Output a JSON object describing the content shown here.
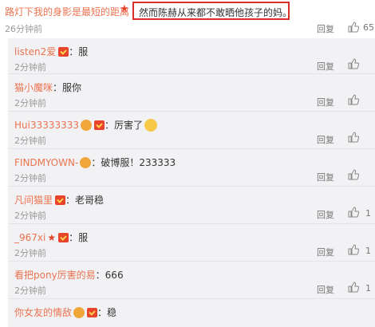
{
  "top_comment": {
    "username": "路灯下我的身影是最短的距离",
    "text": "然而陈赫从来都不敢晒他孩子的妈。",
    "time": "26分钟前",
    "reply_label": "回复",
    "likes": "65"
  },
  "replies": [
    {
      "username": "listen2爱",
      "badge": "vip",
      "text": "：服",
      "time": "2分钟前",
      "reply_label": "回复",
      "likes": ""
    },
    {
      "username": "猫小魔咪",
      "badge": "",
      "text": "：服你",
      "time": "2分钟前",
      "reply_label": "回复",
      "likes": ""
    },
    {
      "username": "Hui33333333",
      "badge": "vip",
      "text": "：厉害了",
      "time": "2分钟前",
      "reply_label": "回复",
      "likes": ""
    },
    {
      "username": "FINDMYOWN-",
      "badge": "vip",
      "text": "：破博服！233333",
      "time": "2分钟前",
      "reply_label": "回复",
      "likes": ""
    },
    {
      "username": "凡间猫里",
      "badge": "vip",
      "text": "：老哥稳",
      "time": "2分钟前",
      "reply_label": "回复",
      "likes": "1"
    },
    {
      "username": "_967xi",
      "badge": "star",
      "text": "：服",
      "time": "2分钟前",
      "reply_label": "回复",
      "likes": "1"
    },
    {
      "username": "看把pony厉害的易",
      "badge": "",
      "text": "：666",
      "time": "2分钟前",
      "reply_label": "回复",
      "likes": "1"
    },
    {
      "username": "你女友的情敌",
      "badge": "vip",
      "text": "：稳",
      "time": "",
      "reply_label": "",
      "likes": ""
    }
  ],
  "colors": {
    "username": "#eb7350",
    "highlight_border": "#d9302a",
    "list_bg": "#f2f2f5"
  },
  "icons": [
    "thumbs-up-icon",
    "vip-badge-icon",
    "star-icon",
    "face-emoji-icon"
  ]
}
